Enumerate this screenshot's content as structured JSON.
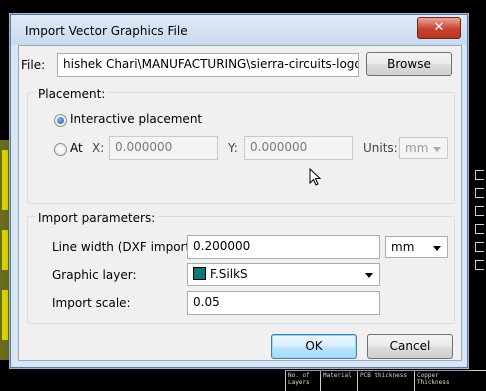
{
  "dialog": {
    "title": "Import Vector Graphics File",
    "close_glyph": "✕"
  },
  "file": {
    "label": "File:",
    "value": "hishek Chari\\MANUFACTURING\\sierra-circuits-logo.dxf",
    "browse_label": "Browse"
  },
  "placement": {
    "group_label": "Placement:",
    "interactive_label": "Interactive placement",
    "interactive_selected": true,
    "at_label": "At",
    "x_label": "X:",
    "x_value": "0.000000",
    "y_label": "Y:",
    "y_value": "0.000000",
    "units_label": "Units:",
    "units_value": "mm"
  },
  "import_params": {
    "group_label": "Import parameters:",
    "line_width_label": "Line width (DXF import):",
    "line_width_value": "0.200000",
    "line_width_units": "mm",
    "graphic_layer_label": "Graphic layer:",
    "graphic_layer_value": "F.SilkS",
    "graphic_layer_color": "#0e7778",
    "import_scale_label": "Import scale:",
    "import_scale_value": "0.05"
  },
  "buttons": {
    "ok_label": "OK",
    "cancel_label": "Cancel"
  },
  "background": {
    "table_cells": [
      "No. of Layers",
      "Material",
      "PCB thickness",
      "Copper Thickness"
    ]
  }
}
